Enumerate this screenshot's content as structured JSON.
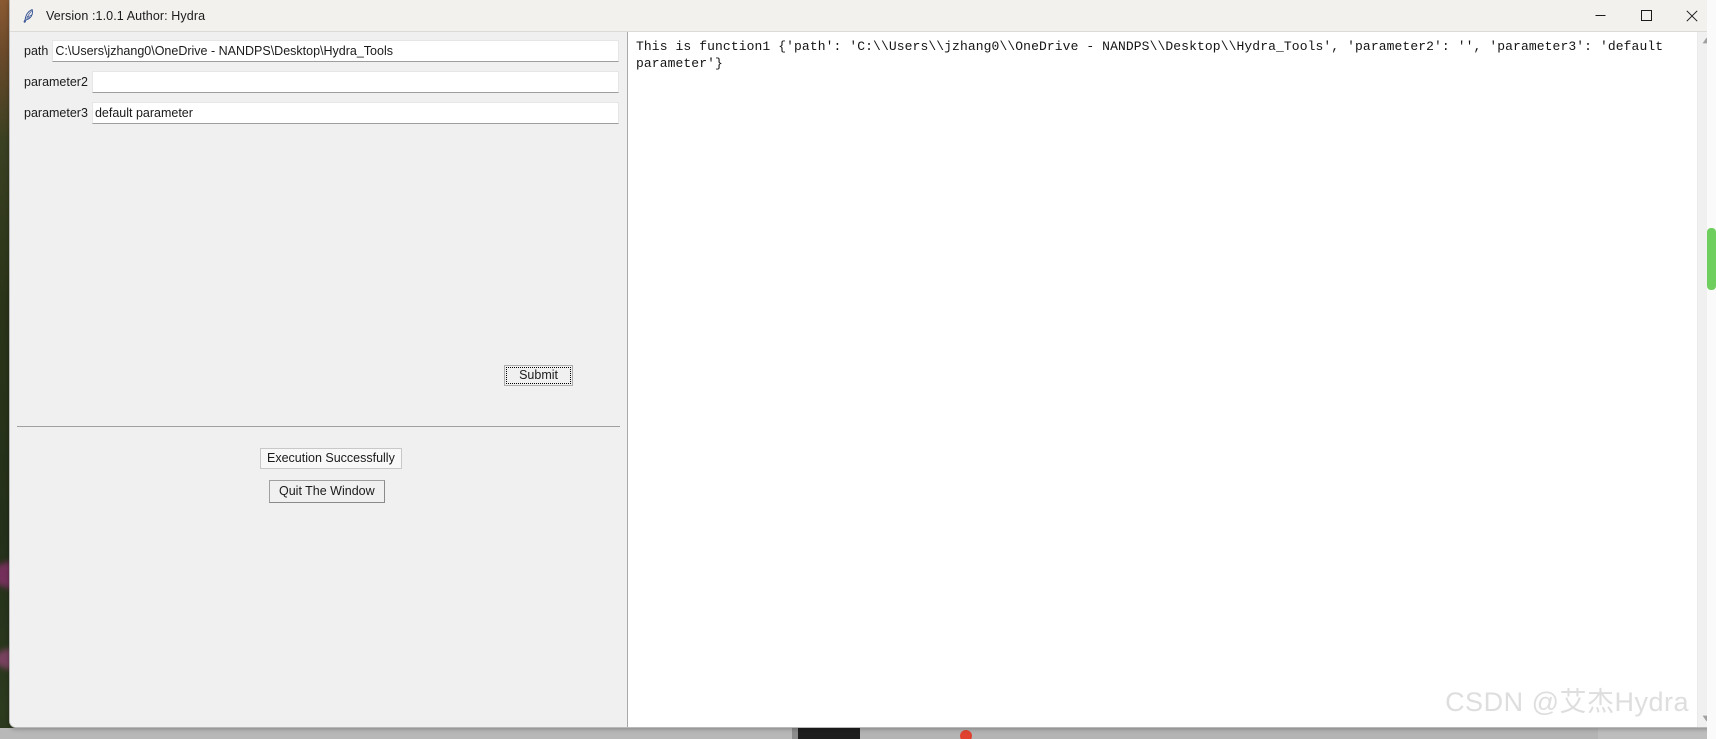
{
  "window": {
    "title": "Version :1.0.1 Author: Hydra",
    "icon": "feather-icon",
    "controls": {
      "minimize": "minimize-icon",
      "maximize": "maximize-icon",
      "close": "close-icon"
    }
  },
  "form": {
    "fields": [
      {
        "label": "path",
        "value": "C:\\Users\\jzhang0\\OneDrive - NANDPS\\Desktop\\Hydra_Tools",
        "placeholder": ""
      },
      {
        "label": "parameter2",
        "value": "",
        "placeholder": ""
      },
      {
        "label": "parameter3",
        "value": "default parameter",
        "placeholder": ""
      }
    ],
    "submit_label": "Submit"
  },
  "status": {
    "message": "Execution Successfully",
    "quit_label": "Quit The Window"
  },
  "output": {
    "text": "This is function1 {'path': 'C:\\\\Users\\\\jzhang0\\\\OneDrive - NANDPS\\\\Desktop\\\\Hydra_Tools', 'parameter2': '', 'parameter3': 'default parameter'}"
  },
  "watermark": {
    "text": "CSDN @艾杰Hydra"
  },
  "colors": {
    "window_bg": "#f0f0f0",
    "titlebar_bg": "#f3f1ee",
    "output_bg": "#ffffff",
    "border": "#a9a9a9",
    "text": "#1b1b1b",
    "watermark": "#dededf",
    "close_hover": "#e81123"
  }
}
